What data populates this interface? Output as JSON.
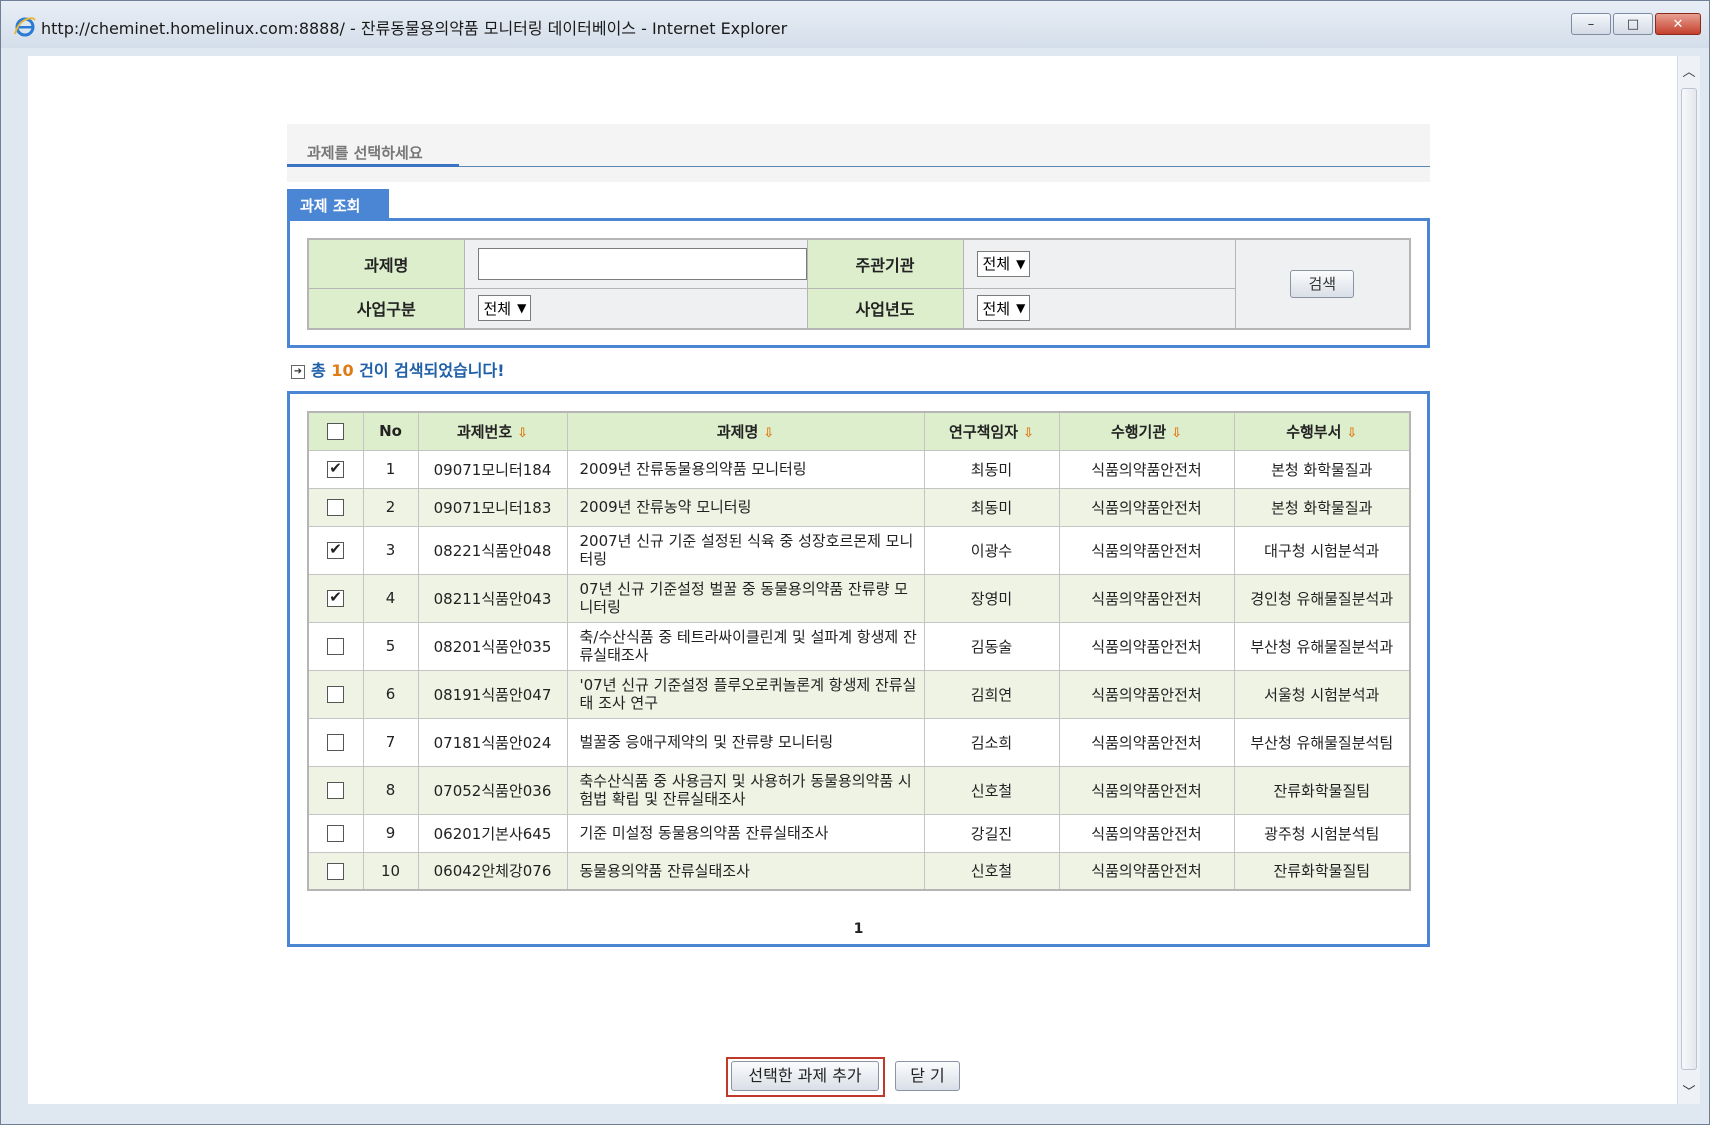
{
  "window": {
    "title": "http://cheminet.homelinux.com:8888/ - 잔류동물용의약품 모니터링 데이터베이스 - Internet Explorer",
    "minimize_label": "–",
    "maximize_label": "□",
    "close_label": "✕"
  },
  "page": {
    "section_title": "과제를 선택하세요",
    "tab_label": "과제 조회"
  },
  "search": {
    "label_name": "과제명",
    "label_agency": "주관기관",
    "label_business": "사업구분",
    "label_year": "사업년도",
    "name_value": "",
    "agency_value": "전체",
    "business_value": "전체",
    "year_value": "전체",
    "search_button": "검색"
  },
  "result": {
    "prefix": "총",
    "count": "10",
    "suffix": "건이 검색되었습니다!"
  },
  "table": {
    "headers": {
      "no": "No",
      "code": "과제번호",
      "title": "과제명",
      "researcher": "연구책임자",
      "agency": "수행기관",
      "dept": "수행부서"
    },
    "rows": [
      {
        "checked": true,
        "no": "1",
        "code": "09071모니터184",
        "title": "2009년 잔류동물용의약품 모니터링",
        "researcher": "최동미",
        "agency": "식품의약품안전처",
        "dept": "본청 화학물질과"
      },
      {
        "checked": false,
        "no": "2",
        "code": "09071모니터183",
        "title": "2009년 잔류농약 모니터링",
        "researcher": "최동미",
        "agency": "식품의약품안전처",
        "dept": "본청 화학물질과"
      },
      {
        "checked": true,
        "no": "3",
        "code": "08221식품안048",
        "title": "2007년 신규 기준 설정된 식육 중 성장호르몬제 모니터링",
        "researcher": "이광수",
        "agency": "식품의약품안전처",
        "dept": "대구청 시험분석과"
      },
      {
        "checked": true,
        "no": "4",
        "code": "08211식품안043",
        "title": "07년 신규 기준설정 벌꿀 중 동물용의약품 잔류량 모니터링",
        "researcher": "장영미",
        "agency": "식품의약품안전처",
        "dept": "경인청 유해물질분석과"
      },
      {
        "checked": false,
        "no": "5",
        "code": "08201식품안035",
        "title": "축/수산식품 중 테트라싸이클린계 및 설파계 항생제 잔류실태조사",
        "researcher": "김동술",
        "agency": "식품의약품안전처",
        "dept": "부산청 유해물질분석과"
      },
      {
        "checked": false,
        "no": "6",
        "code": "08191식품안047",
        "title": "'07년 신규 기준설정 플루오로퀴놀론계 항생제 잔류실태 조사 연구",
        "researcher": "김희연",
        "agency": "식품의약품안전처",
        "dept": "서울청 시험분석과"
      },
      {
        "checked": false,
        "no": "7",
        "code": "07181식품안024",
        "title": "벌꿀중 응애구제약의 및 잔류량 모니터링",
        "researcher": "김소희",
        "agency": "식품의약품안전처",
        "dept": "부산청 유해물질분석팀"
      },
      {
        "checked": false,
        "no": "8",
        "code": "07052식품안036",
        "title": "축수산식품 중 사용금지 및 사용허가 동물용의약품 시험법 확립 및 잔류실태조사",
        "researcher": "신호철",
        "agency": "식품의약품안전처",
        "dept": "잔류화학물질팀"
      },
      {
        "checked": false,
        "no": "9",
        "code": "06201기본사645",
        "title": "기준 미설정 동물용의약품 잔류실태조사",
        "researcher": "강길진",
        "agency": "식품의약품안전처",
        "dept": "광주청 시험분석팀"
      },
      {
        "checked": false,
        "no": "10",
        "code": "06042안체강076",
        "title": "동물용의약품 잔류실태조사",
        "researcher": "신호철",
        "agency": "식품의약품안전처",
        "dept": "잔류화학물질팀"
      }
    ],
    "sort_icon": "sort-down-arrow-icon"
  },
  "pager": {
    "current": "1"
  },
  "buttons": {
    "add_selected": "선택한 과제 추가",
    "close": "닫 기"
  },
  "colors": {
    "accent_blue": "#4a86d4",
    "header_green": "#ddeecc",
    "row_green": "#eef3e4",
    "count_orange": "#e07b14",
    "highlight_red": "#c0392b"
  }
}
